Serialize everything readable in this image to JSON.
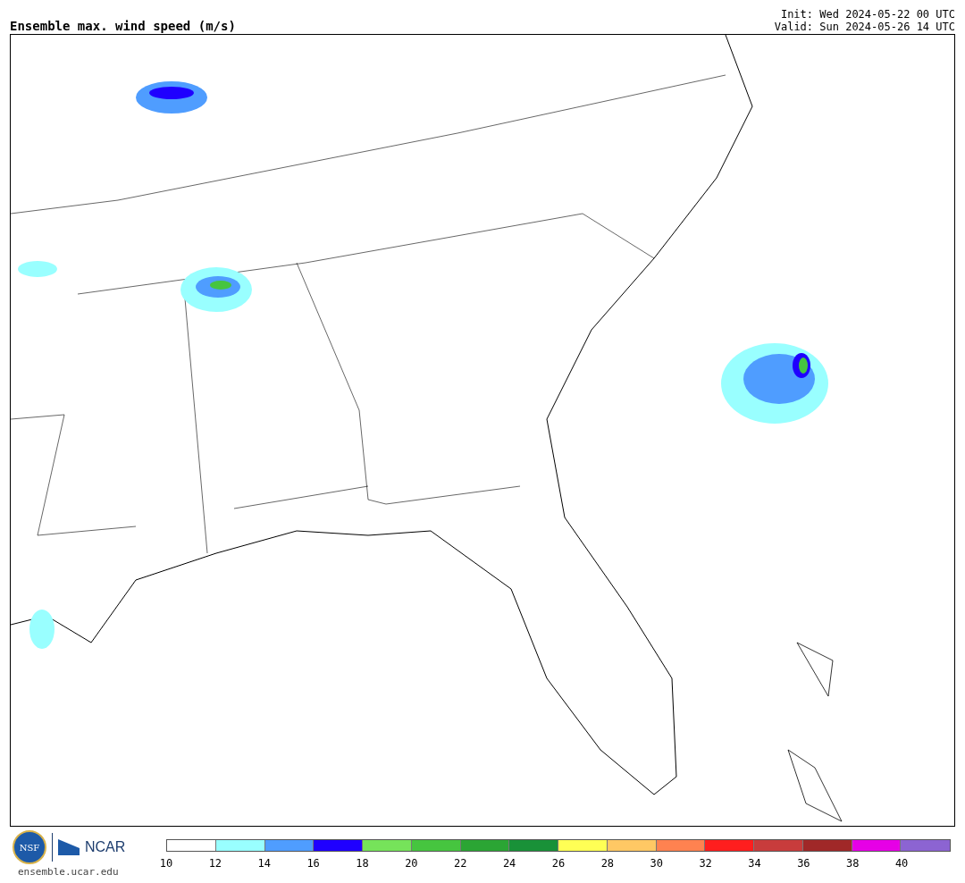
{
  "title": "Ensemble max. wind speed (m/s)",
  "init": "Init: Wed 2024-05-22 00 UTC",
  "valid": "Valid: Sun 2024-05-26 14 UTC",
  "logos": {
    "nsf": "NSF",
    "ncar": "NCAR",
    "url": "ensemble.ucar.edu"
  },
  "colorbar": {
    "bins": [
      {
        "color": "#ffffff"
      },
      {
        "color": "#99ffff"
      },
      {
        "color": "#4f9dff"
      },
      {
        "color": "#1f00ff"
      },
      {
        "color": "#76e35a"
      },
      {
        "color": "#46c53f"
      },
      {
        "color": "#2ba534"
      },
      {
        "color": "#199138"
      },
      {
        "color": "#ffff55"
      },
      {
        "color": "#ffc864"
      },
      {
        "color": "#ff8250"
      },
      {
        "color": "#ff1e1e"
      },
      {
        "color": "#c83c3c"
      },
      {
        "color": "#a02828"
      },
      {
        "color": "#e600e6"
      },
      {
        "color": "#8c64d2"
      }
    ],
    "ticks": [
      "10",
      "12",
      "14",
      "16",
      "18",
      "20",
      "22",
      "24",
      "26",
      "28",
      "30",
      "32",
      "34",
      "36",
      "38",
      "40"
    ]
  }
}
